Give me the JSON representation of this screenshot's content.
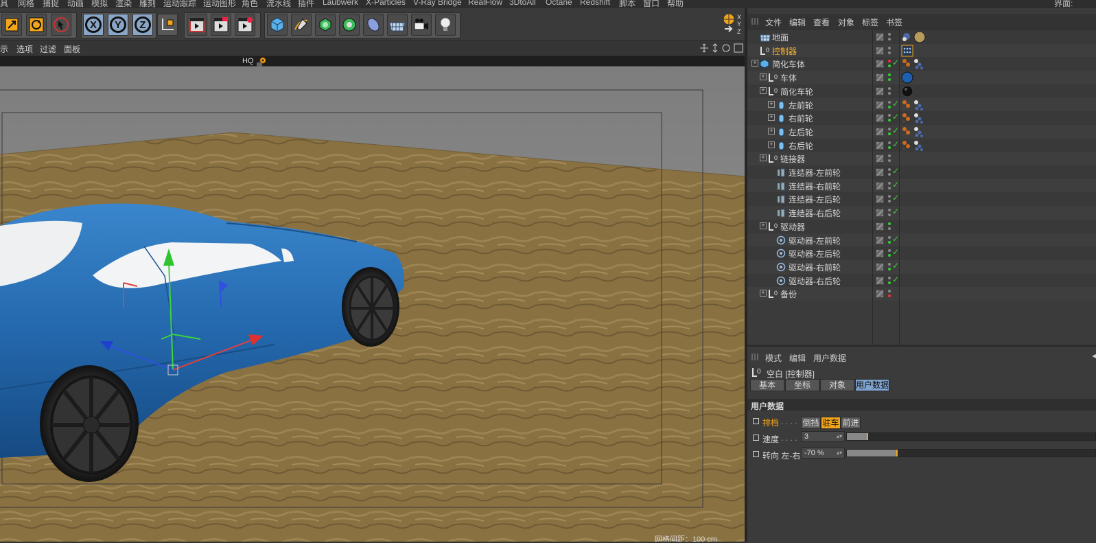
{
  "menubar": {
    "items": [
      "具",
      "网格",
      "捕捉",
      "动画",
      "模拟",
      "渲染",
      "雕刻",
      "运动跟踪",
      "运动图形",
      "角色",
      "流水线",
      "插件",
      "Laubwerk",
      "X-Particles",
      "V-Ray Bridge",
      "RealFlow",
      "3DtoAll",
      "Octane",
      "Redshift",
      "脚本",
      "窗口",
      "帮助"
    ],
    "right_label": "界面:"
  },
  "viewport_menu": {
    "items": [
      "示",
      "选项",
      "过滤",
      "面板"
    ],
    "hq_label": "HQ",
    "status": "网格间距：100 cm"
  },
  "object_manager": {
    "menu": [
      "文件",
      "编辑",
      "查看",
      "对象",
      "标签",
      "书签"
    ],
    "rows": [
      {
        "label": "地面",
        "selected": false
      },
      {
        "label": "控制器",
        "selected": true
      },
      {
        "label": "简化车体",
        "selected": false
      },
      {
        "label": "车体",
        "selected": false
      },
      {
        "label": "简化车轮",
        "selected": false
      },
      {
        "label": "左前轮",
        "selected": false
      },
      {
        "label": "右前轮",
        "selected": false
      },
      {
        "label": "左后轮",
        "selected": false
      },
      {
        "label": "右后轮",
        "selected": false
      },
      {
        "label": "链接器",
        "selected": false
      },
      {
        "label": "连结器-左前轮",
        "selected": false
      },
      {
        "label": "连结器-右前轮",
        "selected": false
      },
      {
        "label": "连结器-左后轮",
        "selected": false
      },
      {
        "label": "连结器-右后轮",
        "selected": false
      },
      {
        "label": "驱动器",
        "selected": false
      },
      {
        "label": "驱动器-左前轮",
        "selected": false
      },
      {
        "label": "驱动器-左后轮",
        "selected": false
      },
      {
        "label": "驱动器-右前轮",
        "selected": false
      },
      {
        "label": "驱动器-右后轮",
        "selected": false
      },
      {
        "label": "备份",
        "selected": false
      }
    ]
  },
  "attribute_manager": {
    "menu": [
      "模式",
      "编辑",
      "用户数据"
    ],
    "object_title": "空白 [控制器]",
    "tabs": [
      "基本",
      "坐标",
      "对象",
      "用户数据"
    ],
    "active_tab": "用户数据",
    "section_title": "用户数据",
    "gear": {
      "label": "排档",
      "dots": ". . . .",
      "options": [
        "倒挡",
        "驻车",
        "前进"
      ],
      "selected": "驻车"
    },
    "speed": {
      "label": "速度",
      "dots": ". . . .",
      "value": "3",
      "slider_fraction": 0.08
    },
    "steer": {
      "label": "转向 左-右",
      "value": "-70 %",
      "slider_fraction": 0.2
    }
  },
  "colors": {
    "accent_orange": "#f2a51a",
    "tab_active": "#7fa3cf",
    "car_blue": "#2a6db0",
    "ground": "#8a7142",
    "check_green": "#47d047"
  }
}
